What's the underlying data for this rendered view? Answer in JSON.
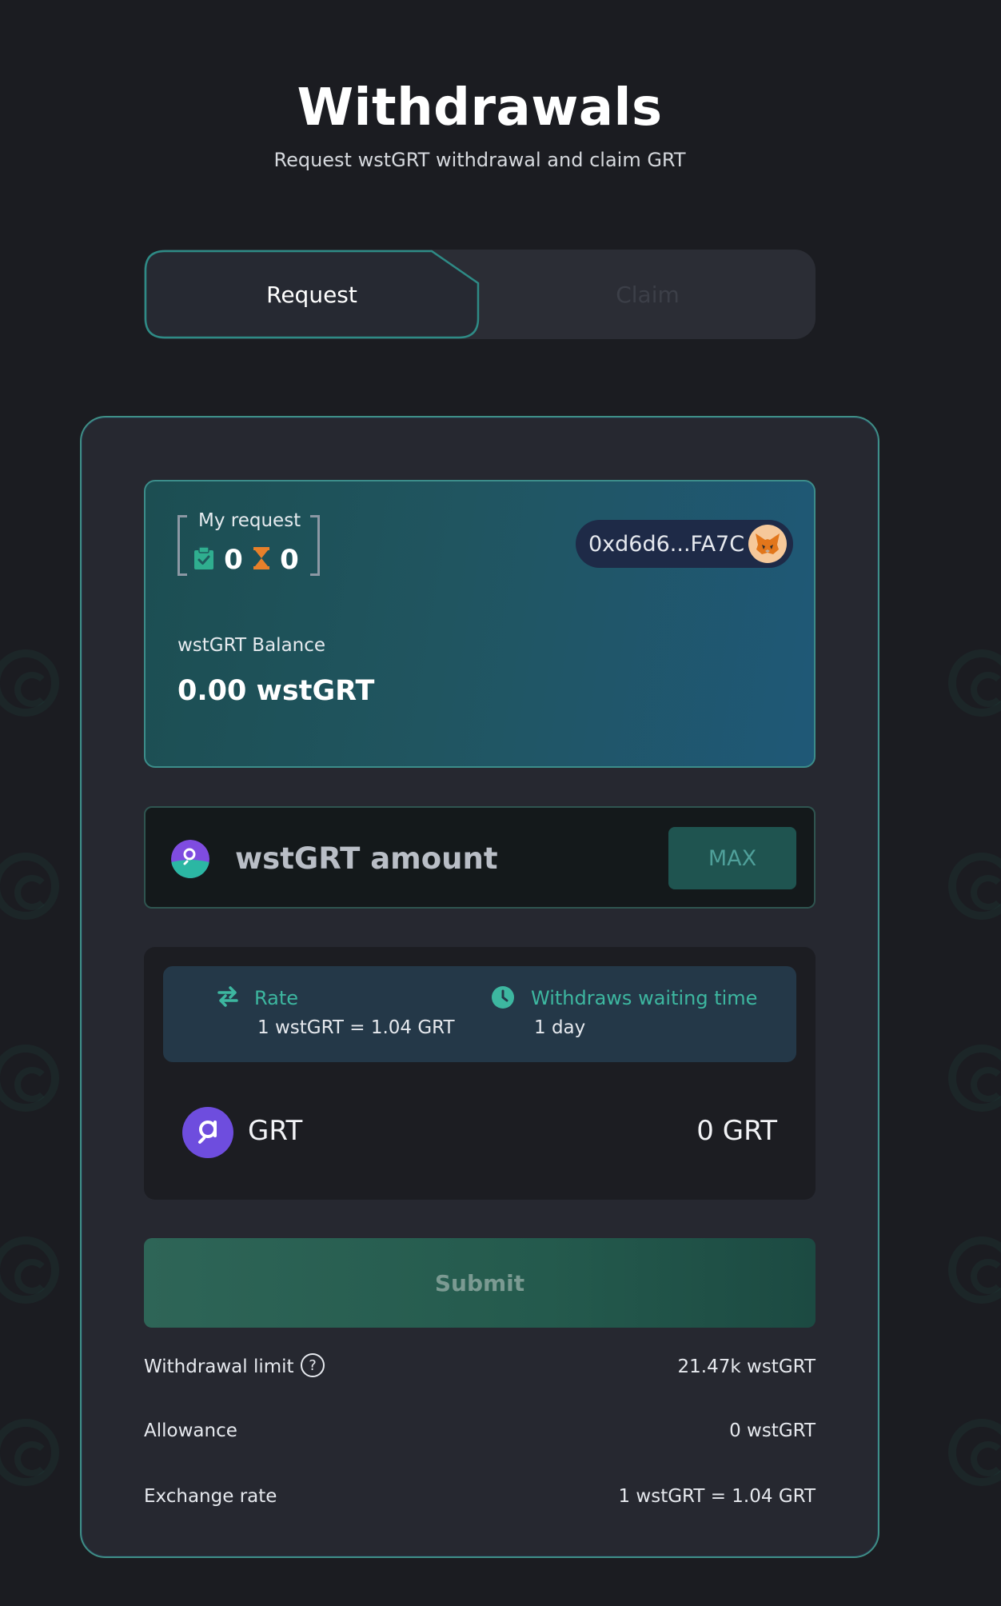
{
  "header": {
    "title": "Withdrawals",
    "subtitle": "Request wstGRT withdrawal and claim GRT"
  },
  "tabs": {
    "request_label": "Request",
    "claim_label": "Claim",
    "active": "Request"
  },
  "my_request": {
    "label": "My request",
    "ready_count": "0",
    "pending_count": "0",
    "ready_icon": "clipboard-check-icon",
    "pending_icon": "hourglass-icon"
  },
  "wallet": {
    "address": "0xd6d6...FA7C",
    "icon": "metamask-fox-icon"
  },
  "balance": {
    "label": "wstGRT Balance",
    "value": "0.00 wstGRT"
  },
  "amount_input": {
    "placeholder": "wstGRT amount",
    "value": "",
    "max_label": "MAX",
    "token_icon": "wstgrt-token-icon"
  },
  "rate": {
    "label": "Rate",
    "value": "1 wstGRT = 1.04 GRT",
    "icon": "swap-arrows-icon"
  },
  "waiting": {
    "label": "Withdraws waiting time",
    "value": "1 day",
    "icon": "clock-icon"
  },
  "output": {
    "token": "GRT",
    "amount": "0 GRT",
    "icon": "grt-token-icon"
  },
  "submit_label": "Submit",
  "details": [
    {
      "key": "Withdrawal limit",
      "value": "21.47k wstGRT",
      "help": "?"
    },
    {
      "key": "Allowance",
      "value": "0 wstGRT"
    },
    {
      "key": "Exchange rate",
      "value": "1 wstGRT = 1.04 GRT"
    }
  ],
  "colors": {
    "background": "#1b1c21",
    "accent": "#3db7a0",
    "card_border": "#3f8f86",
    "submit": "#2e6557"
  }
}
